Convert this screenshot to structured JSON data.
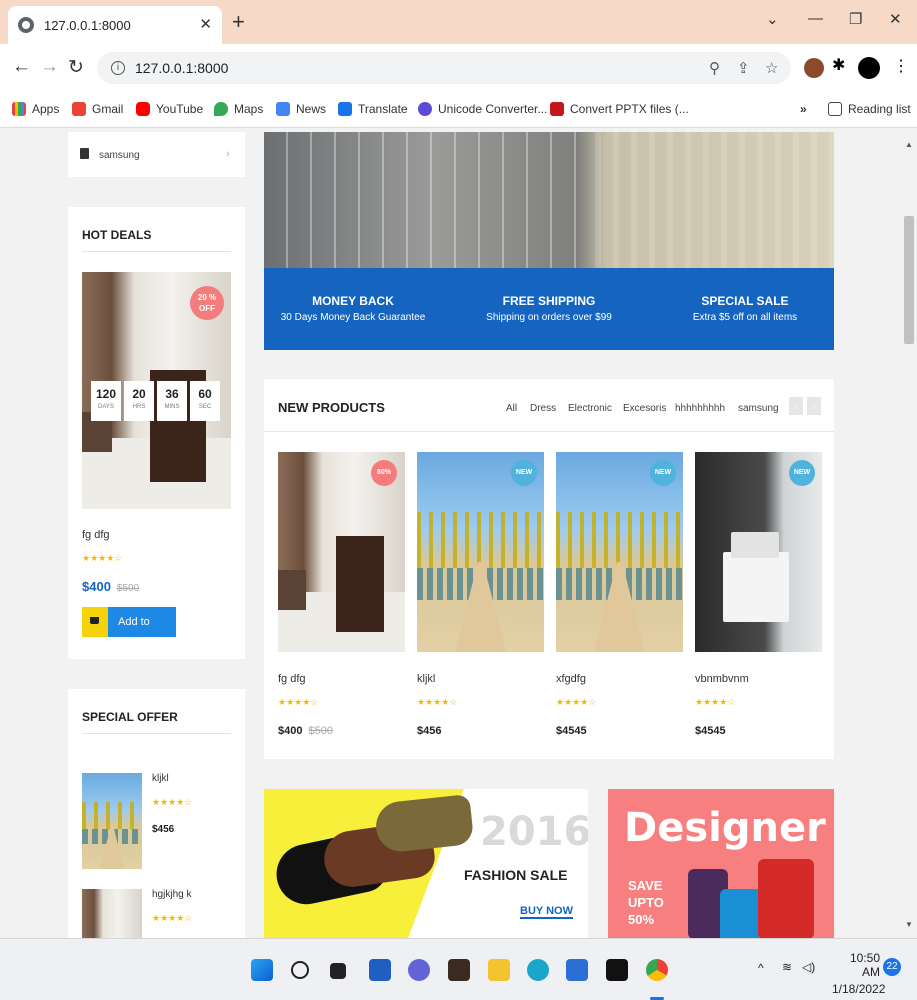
{
  "browser": {
    "tab_title": "127.0.0.1:8000",
    "url": "127.0.0.1:8000",
    "bookmarks": [
      "Apps",
      "Gmail",
      "YouTube",
      "Maps",
      "News",
      "Translate",
      "Unicode Converter...",
      "Convert PPTX files (...",
      "Reading list"
    ],
    "bookmarks_overflow": "»"
  },
  "sidebar": {
    "category_item": "samsung",
    "hot_deals": {
      "title": "HOT DEALS",
      "badge": "20 % OFF",
      "timer": [
        {
          "value": "120",
          "unit": "DAYS"
        },
        {
          "value": "20",
          "unit": "HRS"
        },
        {
          "value": "36",
          "unit": "MINS"
        },
        {
          "value": "60",
          "unit": "SEC"
        }
      ],
      "product_name": "fg dfg",
      "rating": 4,
      "price": "$400",
      "old_price": "$500",
      "add_to_cart": "Add to cart"
    },
    "special_offer": {
      "title": "SPECIAL OFFER",
      "items": [
        {
          "name": "kljkl",
          "rating": 4,
          "price": "$456"
        },
        {
          "name": "hgjkjhg k",
          "rating": 4,
          "price": ""
        }
      ]
    }
  },
  "features": [
    {
      "title": "MONEY BACK",
      "subtitle": "30 Days Money Back Guarantee"
    },
    {
      "title": "FREE SHIPPING",
      "subtitle": "Shipping on orders over $99"
    },
    {
      "title": "SPECIAL SALE",
      "subtitle": "Extra $5 off on all items"
    }
  ],
  "new_products": {
    "title": "NEW PRODUCTS",
    "filters": [
      "All",
      "Dress",
      "Electronic",
      "Excesoris",
      "hhhhhhhhh",
      "samsung"
    ],
    "items": [
      {
        "name": "fg dfg",
        "price": "$400",
        "old_price": "$500",
        "badge": "80%",
        "rating": 4
      },
      {
        "name": "kljkl",
        "price": "$456",
        "old_price": "",
        "badge": "NEW",
        "rating": 4
      },
      {
        "name": "xfgdfg",
        "price": "$4545",
        "old_price": "",
        "badge": "NEW",
        "rating": 4
      },
      {
        "name": "vbnmbvnm",
        "price": "$4545",
        "old_price": "",
        "badge": "NEW",
        "rating": 4
      }
    ]
  },
  "banners": {
    "fashion": {
      "year": "2016",
      "headline": "FASHION SALE",
      "cta": "BUY NOW"
    },
    "designer": {
      "word": "Designer",
      "line1": "SAVE",
      "line2": "UPTO",
      "line3": "50%"
    }
  },
  "taskbar": {
    "time": "10:50 AM",
    "date": "1/18/2022",
    "notification_count": "22"
  },
  "colors": {
    "feature_bar": "#1565c0",
    "badge_sale": "#f47c7c",
    "badge_new": "#4fb3de",
    "cart_blue": "#1e88e5",
    "cart_yellow": "#f5d20a",
    "fashion_bg": "#f7ef3a",
    "designer_bg": "#f77f7f"
  }
}
